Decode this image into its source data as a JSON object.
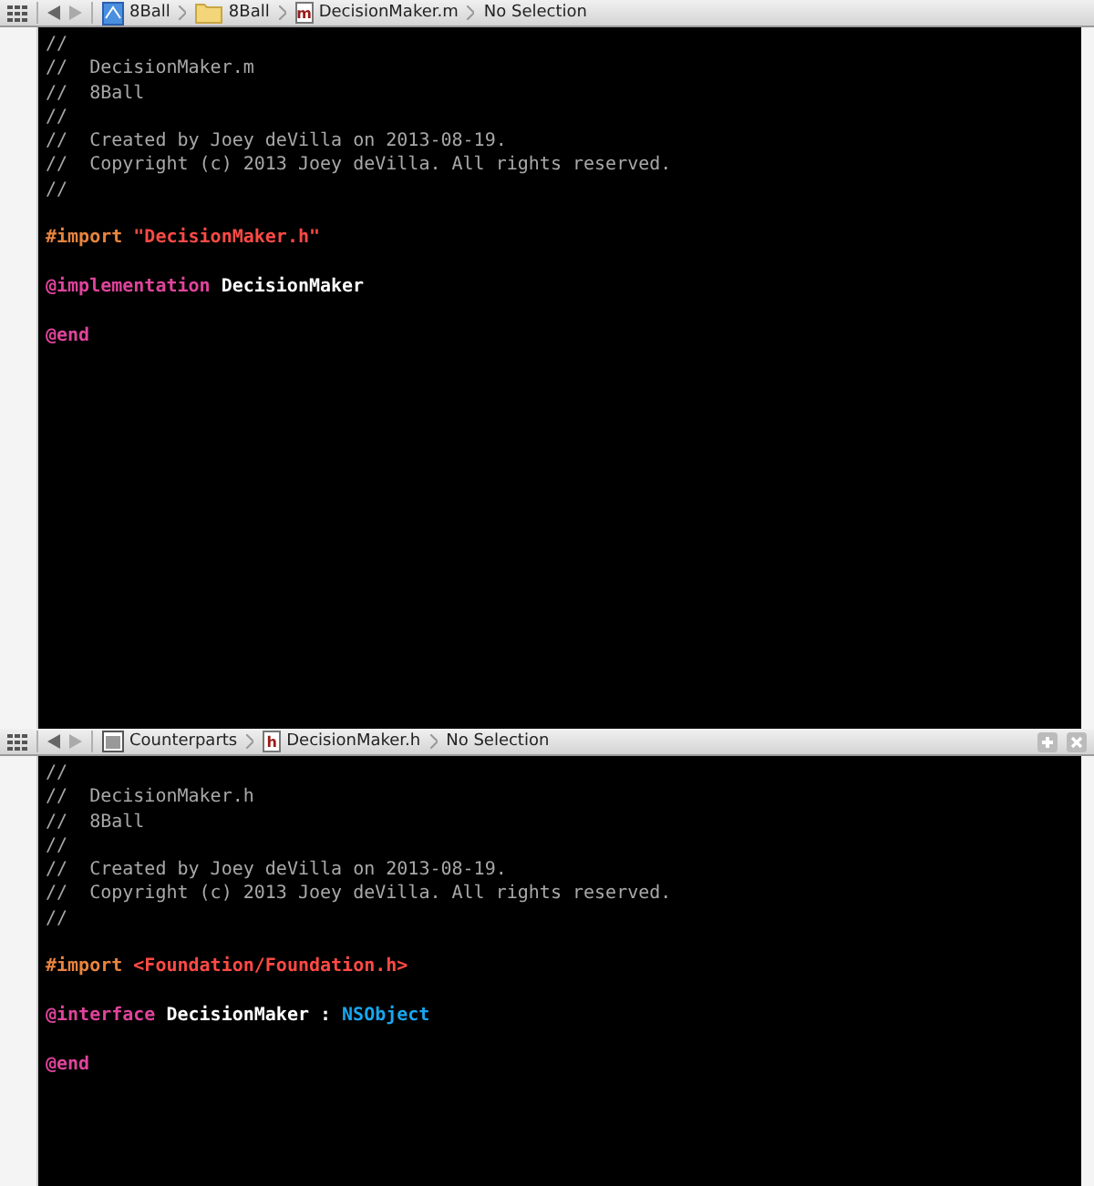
{
  "panes": [
    {
      "jump_bar": {
        "split_buttons": false,
        "crumbs": [
          {
            "kind": "project",
            "label": "8Ball"
          },
          {
            "kind": "folder",
            "label": "8Ball"
          },
          {
            "kind": "file",
            "badge": "m",
            "label": "DecisionMaker.m"
          },
          {
            "kind": "plain",
            "label": "No Selection"
          }
        ]
      },
      "lines": [
        {
          "kind": "code",
          "tokens": [
            {
              "kind": "comment",
              "text": "//"
            }
          ]
        },
        {
          "kind": "code",
          "tokens": [
            {
              "kind": "comment",
              "text": "//  DecisionMaker.m"
            }
          ]
        },
        {
          "kind": "code",
          "tokens": [
            {
              "kind": "comment",
              "text": "//  8Ball"
            }
          ]
        },
        {
          "kind": "code",
          "tokens": [
            {
              "kind": "comment",
              "text": "//"
            }
          ]
        },
        {
          "kind": "code",
          "tokens": [
            {
              "kind": "comment",
              "text": "//  Created by Joey deVilla on 2013-08-19."
            }
          ]
        },
        {
          "kind": "code",
          "tokens": [
            {
              "kind": "comment",
              "text": "//  Copyright (c) 2013 Joey deVilla. All rights reserved."
            }
          ]
        },
        {
          "kind": "code",
          "tokens": [
            {
              "kind": "comment",
              "text": "//"
            }
          ]
        },
        {
          "kind": "blank"
        },
        {
          "kind": "code",
          "tokens": [
            {
              "kind": "preprocessor",
              "text": "#import"
            },
            {
              "kind": "string",
              "text": "\"DecisionMaker.h\""
            }
          ]
        },
        {
          "kind": "blank"
        },
        {
          "kind": "code",
          "tokens": [
            {
              "kind": "keyword",
              "text": "@implementation"
            },
            {
              "kind": "plain",
              "text": "DecisionMaker"
            }
          ]
        },
        {
          "kind": "blank"
        },
        {
          "kind": "code",
          "tokens": [
            {
              "kind": "keyword",
              "text": "@end"
            }
          ]
        }
      ]
    },
    {
      "jump_bar": {
        "split_buttons": true,
        "crumbs": [
          {
            "kind": "counterparts",
            "label": "Counterparts"
          },
          {
            "kind": "file",
            "badge": "h",
            "label": "DecisionMaker.h"
          },
          {
            "kind": "plain",
            "label": "No Selection"
          }
        ]
      },
      "lines": [
        {
          "kind": "code",
          "tokens": [
            {
              "kind": "comment",
              "text": "//"
            }
          ]
        },
        {
          "kind": "code",
          "tokens": [
            {
              "kind": "comment",
              "text": "//  DecisionMaker.h"
            }
          ]
        },
        {
          "kind": "code",
          "tokens": [
            {
              "kind": "comment",
              "text": "//  8Ball"
            }
          ]
        },
        {
          "kind": "code",
          "tokens": [
            {
              "kind": "comment",
              "text": "//"
            }
          ]
        },
        {
          "kind": "code",
          "tokens": [
            {
              "kind": "comment",
              "text": "//  Created by Joey deVilla on 2013-08-19."
            }
          ]
        },
        {
          "kind": "code",
          "tokens": [
            {
              "kind": "comment",
              "text": "//  Copyright (c) 2013 Joey deVilla. All rights reserved."
            }
          ]
        },
        {
          "kind": "code",
          "tokens": [
            {
              "kind": "comment",
              "text": "//"
            }
          ]
        },
        {
          "kind": "blank"
        },
        {
          "kind": "code",
          "tokens": [
            {
              "kind": "preprocessor",
              "text": "#import"
            },
            {
              "kind": "string",
              "text": "<Foundation/Foundation.h>"
            }
          ]
        },
        {
          "kind": "blank"
        },
        {
          "kind": "code",
          "tokens": [
            {
              "kind": "keyword",
              "text": "@interface"
            },
            {
              "kind": "plain",
              "text": "DecisionMaker"
            },
            {
              "kind": "plain",
              "text": ":"
            },
            {
              "kind": "type",
              "text": "NSObject"
            }
          ]
        },
        {
          "kind": "blank"
        },
        {
          "kind": "code",
          "tokens": [
            {
              "kind": "keyword",
              "text": "@end"
            }
          ]
        }
      ]
    }
  ]
}
